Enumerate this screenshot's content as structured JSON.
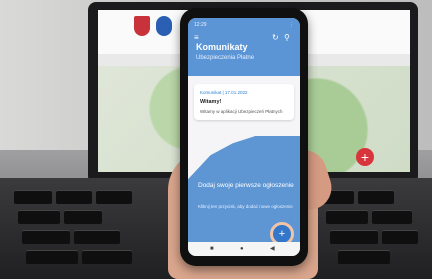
{
  "app": {
    "title": "Komunikaty",
    "subtitle": "Ubezpieczenia Płatne",
    "status_left": "12:29",
    "status_right": "⋮",
    "card_meta": "Komunikat | 17.01.2022",
    "card_title": "Witamy!",
    "card_text": "Witamy w aplikacji Ubezpieczeń Płatnych",
    "cta_title": "Dodaj swoje pierwsze ogłoszenie",
    "cta_text": "Kliknij ten przycisk, aby dodać nowe ogłoszenie",
    "fab_label": "+"
  },
  "laptop": {
    "red_fab": "+"
  },
  "icons": {
    "menu": "menu-icon",
    "refresh": "refresh-icon",
    "filter": "filter-icon"
  }
}
